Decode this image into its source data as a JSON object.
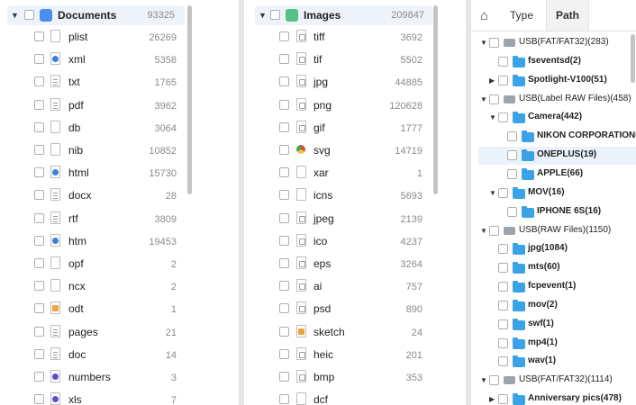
{
  "panel1": {
    "category": {
      "label": "Documents",
      "count": "93325",
      "icon": "document-category-icon",
      "color": "#4a8ef0"
    },
    "items": [
      {
        "name": "plist",
        "count": "26269",
        "icon": "generic"
      },
      {
        "name": "xml",
        "count": "5358",
        "icon": "blue"
      },
      {
        "name": "txt",
        "count": "1765",
        "icon": "text"
      },
      {
        "name": "pdf",
        "count": "3962",
        "icon": "text"
      },
      {
        "name": "db",
        "count": "3064",
        "icon": "generic"
      },
      {
        "name": "nib",
        "count": "10852",
        "icon": "generic"
      },
      {
        "name": "html",
        "count": "15730",
        "icon": "blue"
      },
      {
        "name": "docx",
        "count": "28",
        "icon": "pencil"
      },
      {
        "name": "rtf",
        "count": "3809",
        "icon": "text"
      },
      {
        "name": "htm",
        "count": "19453",
        "icon": "blue"
      },
      {
        "name": "opf",
        "count": "2",
        "icon": "generic"
      },
      {
        "name": "ncx",
        "count": "2",
        "icon": "generic"
      },
      {
        "name": "odt",
        "count": "1",
        "icon": "orange"
      },
      {
        "name": "pages",
        "count": "21",
        "icon": "pencil"
      },
      {
        "name": "doc",
        "count": "14",
        "icon": "pencil"
      },
      {
        "name": "numbers",
        "count": "3",
        "icon": "purple"
      },
      {
        "name": "xls",
        "count": "7",
        "icon": "purple"
      }
    ]
  },
  "panel2": {
    "category": {
      "label": "Images",
      "count": "209847",
      "icon": "image-category-icon",
      "color": "#57c084"
    },
    "items": [
      {
        "name": "tiff",
        "count": "3692",
        "icon": "image"
      },
      {
        "name": "tif",
        "count": "5502",
        "icon": "image"
      },
      {
        "name": "jpg",
        "count": "44885",
        "icon": "image"
      },
      {
        "name": "png",
        "count": "120628",
        "icon": "image"
      },
      {
        "name": "gif",
        "count": "1777",
        "icon": "image"
      },
      {
        "name": "svg",
        "count": "14719",
        "icon": "chrome"
      },
      {
        "name": "xar",
        "count": "1",
        "icon": "generic"
      },
      {
        "name": "icns",
        "count": "5693",
        "icon": "generic"
      },
      {
        "name": "jpeg",
        "count": "2139",
        "icon": "image"
      },
      {
        "name": "ico",
        "count": "4237",
        "icon": "image"
      },
      {
        "name": "eps",
        "count": "3264",
        "icon": "image"
      },
      {
        "name": "ai",
        "count": "757",
        "icon": "image"
      },
      {
        "name": "psd",
        "count": "890",
        "icon": "image"
      },
      {
        "name": "sketch",
        "count": "24",
        "icon": "orange"
      },
      {
        "name": "heic",
        "count": "201",
        "icon": "image"
      },
      {
        "name": "bmp",
        "count": "353",
        "icon": "image"
      },
      {
        "name": "dcf",
        "count": "",
        "icon": "generic"
      }
    ]
  },
  "panel3": {
    "tabs": [
      "Type",
      "Path"
    ],
    "active_tab": "Path",
    "home_icon": "home-icon",
    "tree": [
      {
        "label": "USB(FAT/FAT32)(283)",
        "kind": "drive",
        "level": 0,
        "chev": "down"
      },
      {
        "label": "fseventsd(2)",
        "kind": "folder",
        "level": 1,
        "chev": ""
      },
      {
        "label": "Spotlight-V100(51)",
        "kind": "folder",
        "level": 1,
        "chev": "right"
      },
      {
        "label": "USB(Label RAW Files)(458)",
        "kind": "drive",
        "level": 0,
        "chev": "down"
      },
      {
        "label": "Camera(442)",
        "kind": "folder",
        "level": 1,
        "chev": "down"
      },
      {
        "label": "NIKON CORPORATION(:",
        "kind": "folder",
        "level": 2,
        "chev": ""
      },
      {
        "label": "ONEPLUS(19)",
        "kind": "folder",
        "level": 2,
        "chev": "",
        "selected": true
      },
      {
        "label": "APPLE(66)",
        "kind": "folder",
        "level": 2,
        "chev": ""
      },
      {
        "label": "MOV(16)",
        "kind": "folder",
        "level": 1,
        "chev": "down"
      },
      {
        "label": "IPHONE 6S(16)",
        "kind": "folder",
        "level": 2,
        "chev": ""
      },
      {
        "label": "USB(RAW Files)(1150)",
        "kind": "drive",
        "level": 0,
        "chev": "down"
      },
      {
        "label": "jpg(1084)",
        "kind": "folder",
        "level": 1,
        "chev": ""
      },
      {
        "label": "mts(60)",
        "kind": "folder",
        "level": 1,
        "chev": ""
      },
      {
        "label": "fcpevent(1)",
        "kind": "folder",
        "level": 1,
        "chev": ""
      },
      {
        "label": "mov(2)",
        "kind": "folder",
        "level": 1,
        "chev": ""
      },
      {
        "label": "swf(1)",
        "kind": "folder",
        "level": 1,
        "chev": ""
      },
      {
        "label": "mp4(1)",
        "kind": "folder",
        "level": 1,
        "chev": ""
      },
      {
        "label": "wav(1)",
        "kind": "folder",
        "level": 1,
        "chev": ""
      },
      {
        "label": "USB(FAT/FAT32)(1114)",
        "kind": "drive",
        "level": 0,
        "chev": "down"
      },
      {
        "label": "Anniversary pics(478)",
        "kind": "folder",
        "level": 1,
        "chev": "right"
      }
    ]
  },
  "colors": {
    "folder": "#3aa3e8",
    "drive": "#9ea4ab",
    "selected_bg": "#eaf2fb",
    "header_bg": "#eef3fb"
  }
}
